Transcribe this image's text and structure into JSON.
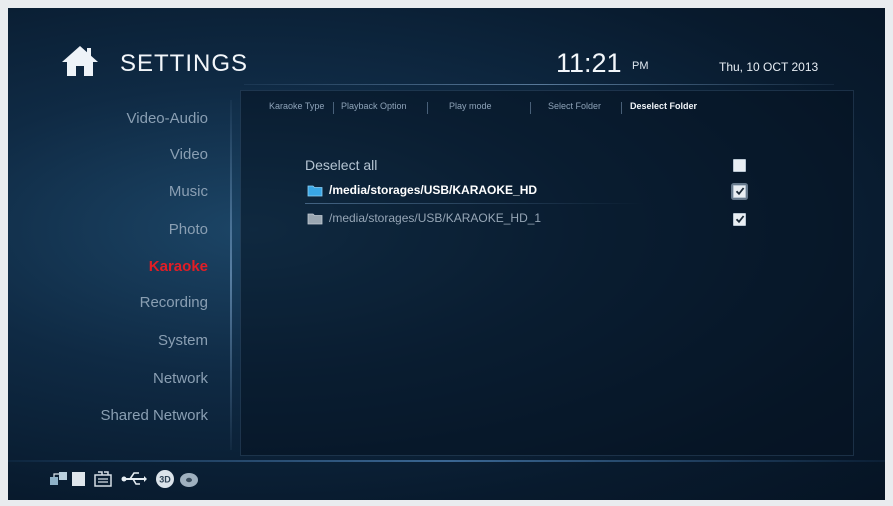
{
  "header": {
    "title": "SETTINGS",
    "time": "11:21",
    "ampm": "PM",
    "date": "Thu, 10 OCT 2013",
    "home_icon": "home-icon"
  },
  "sidebar": {
    "items": [
      {
        "label": "Video-Audio",
        "active": false
      },
      {
        "label": "Video",
        "active": false
      },
      {
        "label": "Music",
        "active": false
      },
      {
        "label": "Photo",
        "active": false
      },
      {
        "label": "Karaoke",
        "active": true
      },
      {
        "label": "Recording",
        "active": false
      },
      {
        "label": "System",
        "active": false
      },
      {
        "label": "Network",
        "active": false
      },
      {
        "label": "Shared Network",
        "active": false
      }
    ],
    "active_color": "#e21d25"
  },
  "tabs": [
    {
      "label": "Karaoke Type",
      "active": false
    },
    {
      "label": "Playback Option",
      "active": false
    },
    {
      "label": "Play mode",
      "active": false
    },
    {
      "label": "Select Folder",
      "active": false
    },
    {
      "label": "Deselect Folder",
      "active": true
    }
  ],
  "content": {
    "deselect_all_label": "Deselect all",
    "deselect_all_checked": false,
    "folders": [
      {
        "path": "/media/storages/USB/KARAOKE_HD",
        "checked": true,
        "highlighted": true,
        "icon": "folder-blue-icon"
      },
      {
        "path": "/media/storages/USB/KARAOKE_HD_1",
        "checked": true,
        "highlighted": false,
        "icon": "folder-gray-icon"
      }
    ]
  },
  "status_bar": {
    "icons": [
      "network-icon",
      "storage-icon",
      "sd-card-icon",
      "usb-icon",
      "3d-icon",
      "disc-icon"
    ]
  }
}
